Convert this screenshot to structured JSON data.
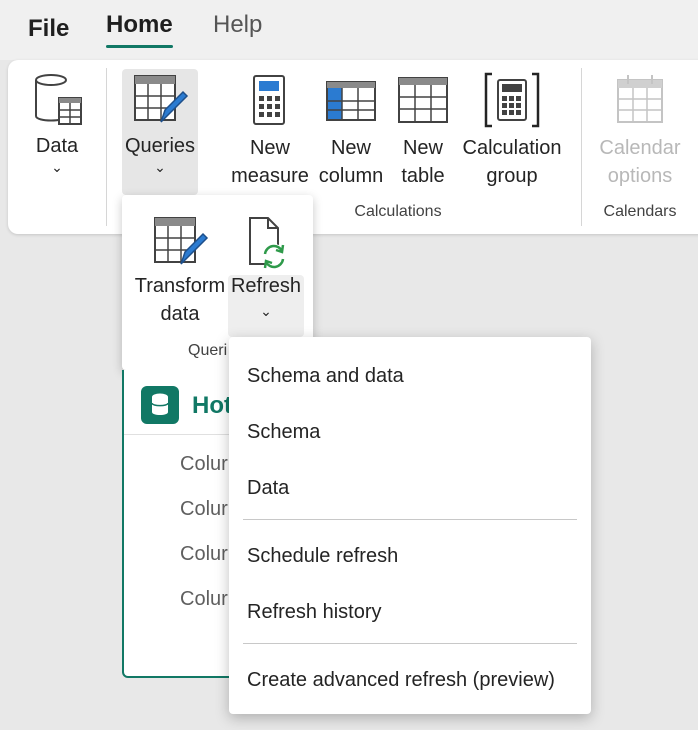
{
  "tabs": {
    "file": "File",
    "home": "Home",
    "help": "Help"
  },
  "ribbon": {
    "data_label": "Data",
    "queries_label": "Queries",
    "new_measure": [
      "New",
      "measure"
    ],
    "new_column": [
      "New",
      "column"
    ],
    "new_table": [
      "New",
      "table"
    ],
    "calculation_group": [
      "Calculation",
      "group"
    ],
    "calendar_options": [
      "Calendar",
      "options"
    ],
    "group_calculations": "Calculations",
    "group_calendars": "Calendars",
    "chevron": "⌄"
  },
  "queries_popup": {
    "transform": [
      "Transform",
      "data"
    ],
    "refresh": "Refresh",
    "group_label": "Queri"
  },
  "panel": {
    "table_name": "Hot",
    "columns": [
      "Colur",
      "Colur",
      "Colur",
      "Colur"
    ]
  },
  "refresh_menu": {
    "items": [
      "Schema and data",
      "Schema",
      "Data",
      "Schedule refresh",
      "Refresh history",
      "Create advanced refresh (preview)"
    ]
  },
  "colors": {
    "accent": "#117865",
    "blue": "#2b7bd1",
    "green": "#2e9a4a",
    "disabled": "#b8b8b8"
  }
}
